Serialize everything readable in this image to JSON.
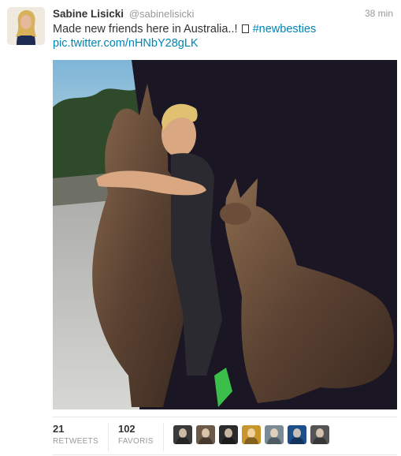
{
  "tweet": {
    "fullname": "Sabine Lisicki",
    "username": "@sabinelisicki",
    "timestamp": "38 min",
    "text_main": "Made new friends here in Australia..!",
    "hashtag": "#newbesties",
    "link": "pic.twitter.com/nHNbY28gLK"
  },
  "stats": {
    "retweets_count": "21",
    "retweets_label": "RETWEETS",
    "favorites_count": "102",
    "favorites_label": "FAVORIS"
  },
  "favoriters": [
    {
      "name": "favoriter-avatar-1",
      "color": "#3a3a3a"
    },
    {
      "name": "favoriter-avatar-2",
      "color": "#6b5a4a"
    },
    {
      "name": "favoriter-avatar-3",
      "color": "#2b2b2b"
    },
    {
      "name": "favoriter-avatar-4",
      "color": "#c9962e"
    },
    {
      "name": "favoriter-avatar-5",
      "color": "#7a8b95"
    },
    {
      "name": "favoriter-avatar-6",
      "color": "#1d4f8a"
    },
    {
      "name": "favoriter-avatar-7",
      "color": "#555555"
    }
  ],
  "colors": {
    "link": "#0084b4",
    "muted": "#999999",
    "text": "#333333"
  }
}
